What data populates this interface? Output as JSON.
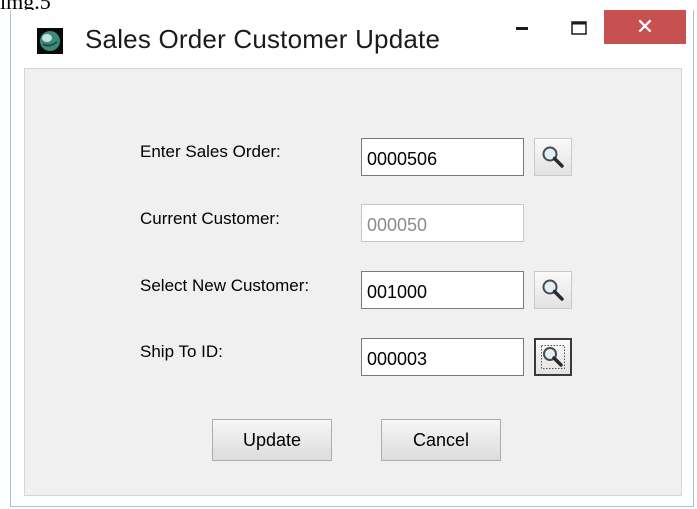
{
  "caption": "img.5",
  "window": {
    "title": "Sales Order Customer Update",
    "close_glyph": "✕",
    "accent_close": "#c75050"
  },
  "form": {
    "sales_order": {
      "label": "Enter Sales Order:",
      "value": "0000506",
      "lookup_icon": "magnifier-icon"
    },
    "current_customer": {
      "label": "Current Customer:",
      "value": "000050"
    },
    "new_customer": {
      "label": "Select New Customer:",
      "value": "001000",
      "lookup_icon": "magnifier-icon"
    },
    "ship_to": {
      "label": "Ship To ID:",
      "value": "000003",
      "lookup_icon": "magnifier-icon"
    }
  },
  "buttons": {
    "update_label": "Update",
    "cancel_label": "Cancel"
  }
}
